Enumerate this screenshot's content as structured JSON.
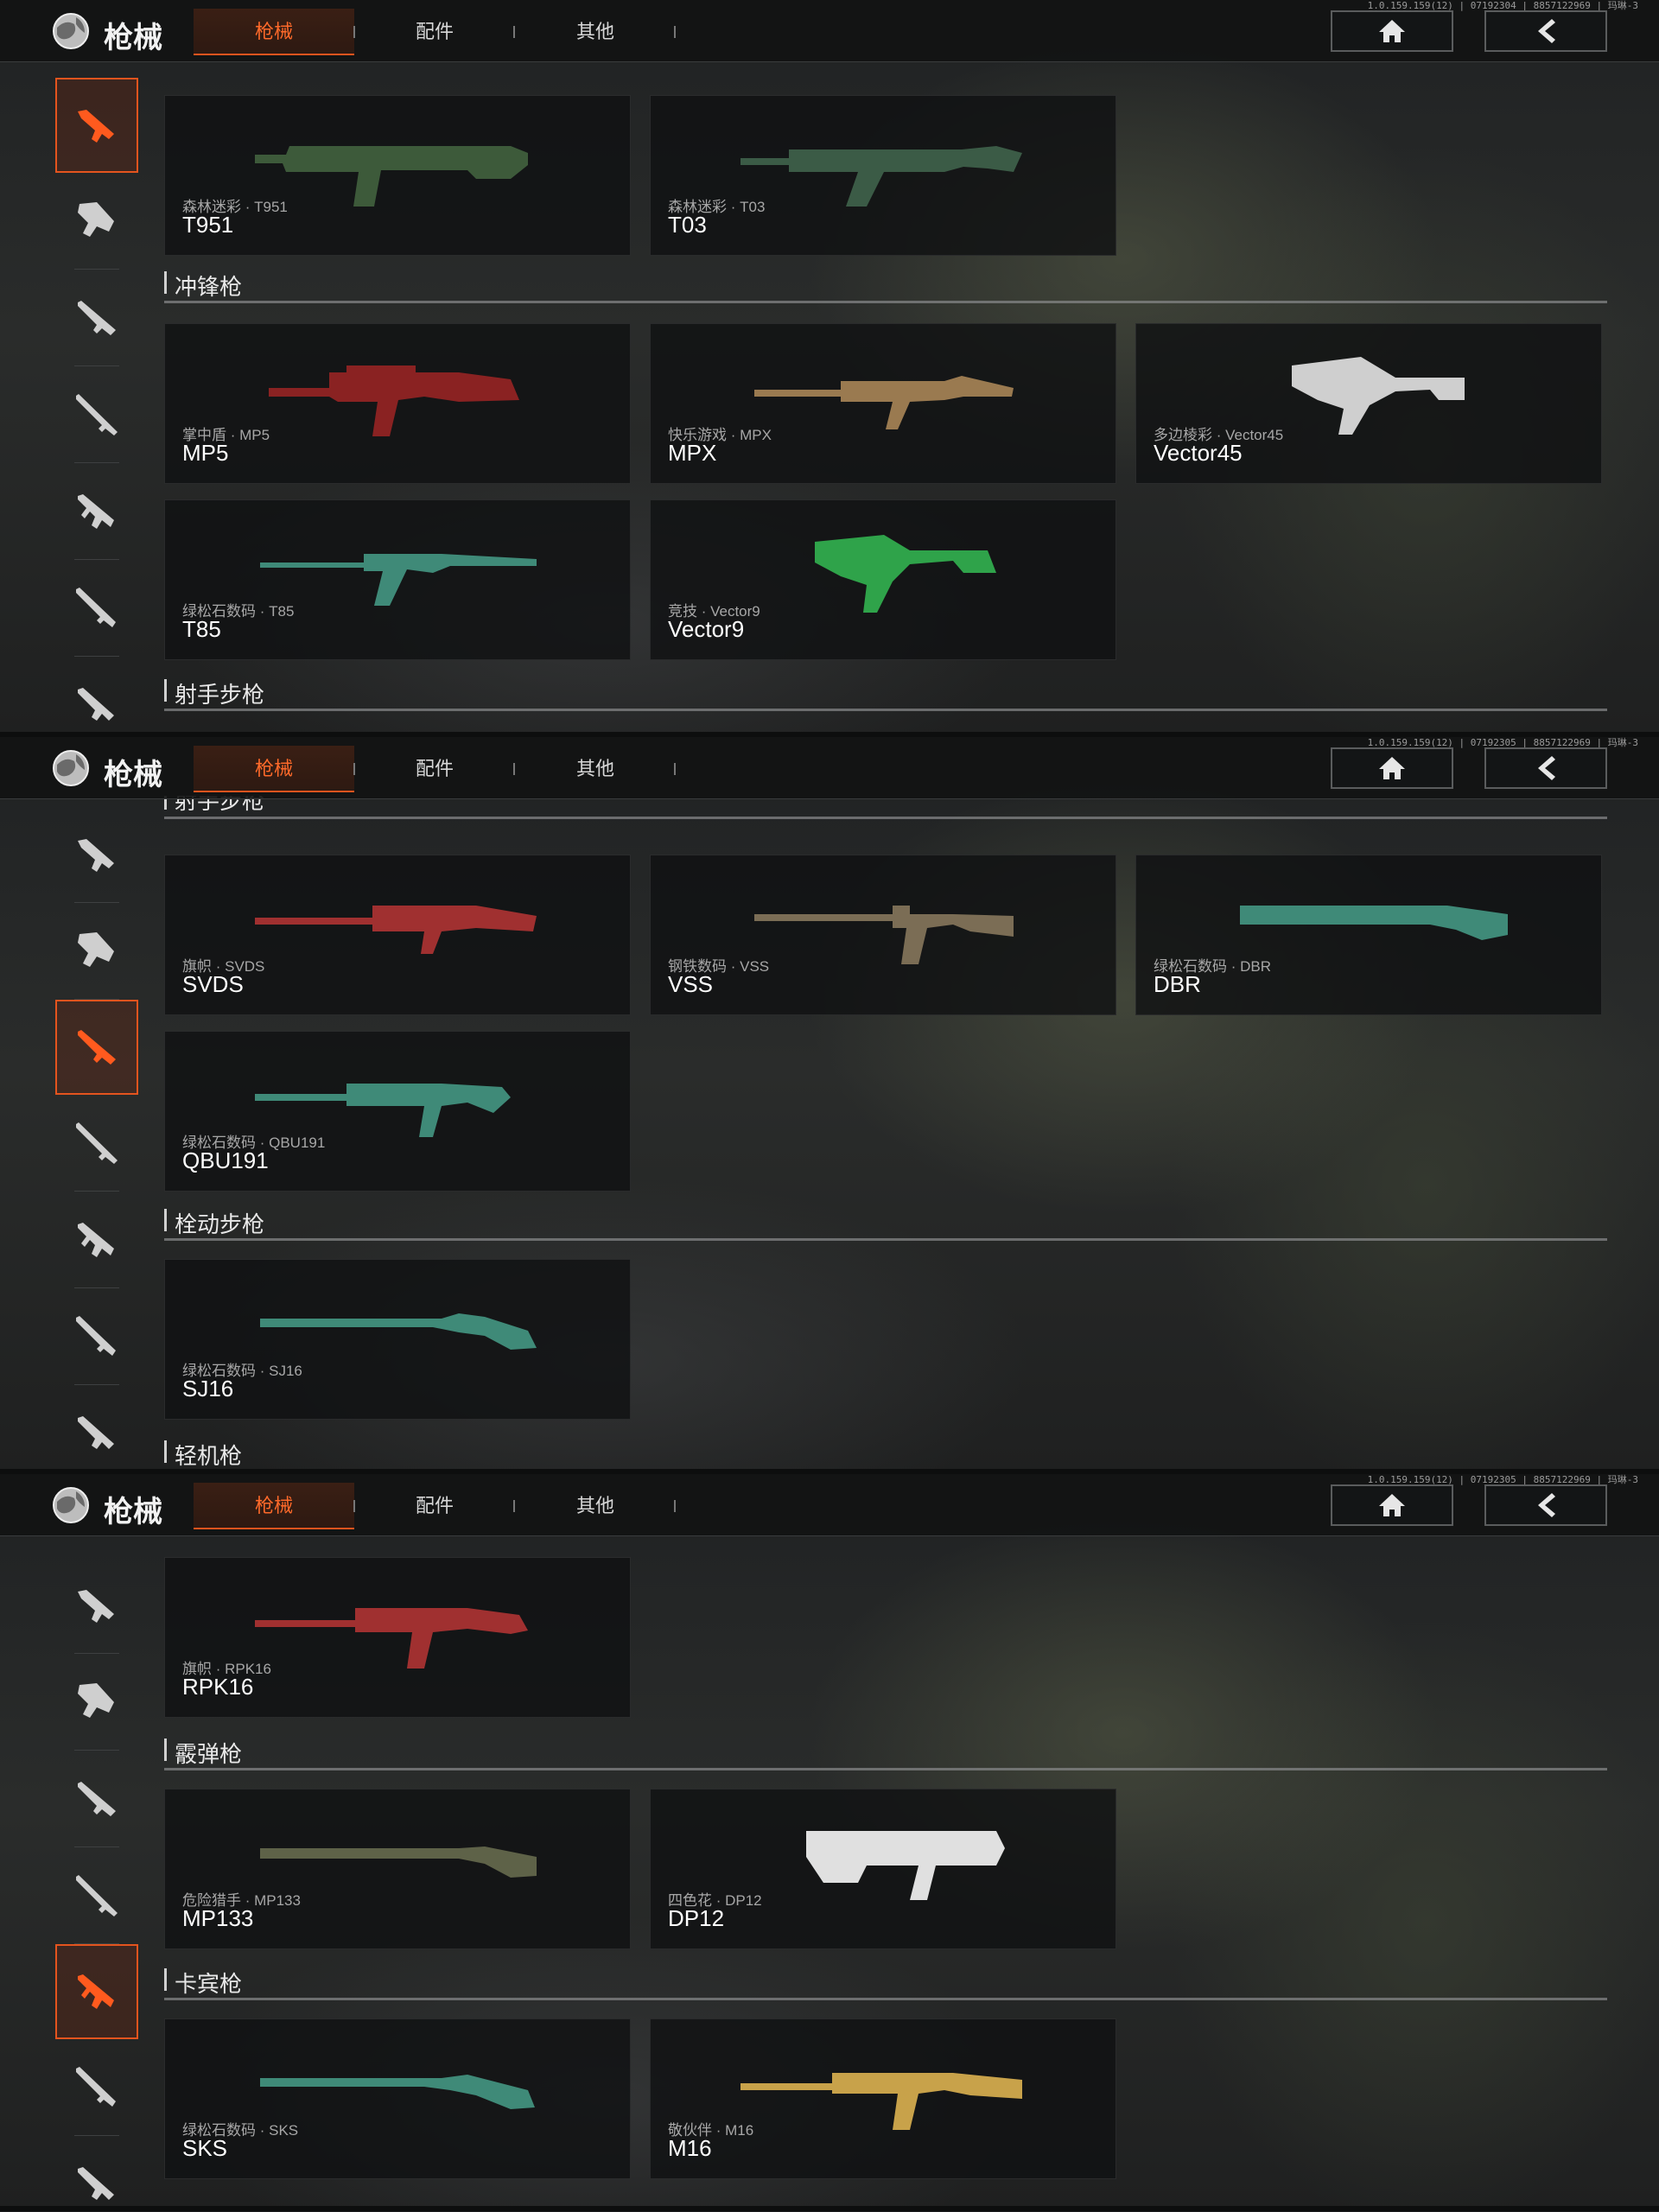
{
  "topbar": {
    "title": "枪械",
    "tabs": [
      "枪械",
      "配件",
      "其他"
    ],
    "versions": [
      "1.0.159.159(12) | 07192304 | 8857122969 | 玛琳-3",
      "1.0.159.159(12) | 07192305 | 8857122969 | 玛琳-3",
      "1.0.159.159(12) | 07192305 | 8857122969 | 玛琳-3"
    ],
    "home_icon": "home-icon",
    "back_icon": "chevron-left-icon"
  },
  "colors": {
    "accent": "#e4541e",
    "text": "#ffffff",
    "skin_text": "#a7a7a7"
  },
  "panel1": {
    "rifles": [
      {
        "skin": "森林迷彩 · T951",
        "name": "T951",
        "color": "#3d5a3a"
      },
      {
        "skin": "森林迷彩 · T03",
        "name": "T03",
        "color": "#3b5b46"
      }
    ],
    "smg_section": "冲锋枪",
    "smgs": [
      {
        "skin": "掌中盾 · MP5",
        "name": "MP5",
        "color": "#8a2222"
      },
      {
        "skin": "快乐游戏 · MPX",
        "name": "MPX",
        "color": "#9a7a50"
      },
      {
        "skin": "多边棱彩 · Vector45",
        "name": "Vector45",
        "color": "#cfcfcf"
      },
      {
        "skin": "绿松石数码 · T85",
        "name": "T85",
        "color": "#3f8a78"
      },
      {
        "skin": "竞技 · Vector9",
        "name": "Vector9",
        "color": "#2fa34a"
      }
    ],
    "dmr_section": "射手步枪"
  },
  "panel2": {
    "dmr_section_partial": "射手步枪",
    "dmrs": [
      {
        "skin": "旗帜 · SVDS",
        "name": "SVDS",
        "color": "#a03030"
      },
      {
        "skin": "钢铁数码 · VSS",
        "name": "VSS",
        "color": "#7b6d55"
      },
      {
        "skin": "绿松石数码 · DBR",
        "name": "DBR",
        "color": "#3f8a78"
      },
      {
        "skin": "绿松石数码 · QBU191",
        "name": "QBU191",
        "color": "#3f8a78"
      }
    ],
    "sniper_section": "栓动步枪",
    "snipers": [
      {
        "skin": "绿松石数码 · SJ16",
        "name": "SJ16",
        "color": "#3f8a78"
      }
    ],
    "lmg_section": "轻机枪"
  },
  "panel3": {
    "lmgs": [
      {
        "skin": "旗帜 · RPK16",
        "name": "RPK16",
        "color": "#a03030"
      }
    ],
    "shotgun_section": "霰弹枪",
    "shotguns": [
      {
        "skin": "危险猎手 · MP133",
        "name": "MP133",
        "color": "#5e6248"
      },
      {
        "skin": "四色花 · DP12",
        "name": "DP12",
        "color": "#e0e0e0"
      }
    ],
    "carbine_section": "卡宾枪",
    "carbines": [
      {
        "skin": "绿松石数码 · SKS",
        "name": "SKS",
        "color": "#3f8a78"
      },
      {
        "skin": "敬伙伴 · M16",
        "name": "M16",
        "color": "#c8a24a"
      }
    ]
  },
  "sidebar_icons": [
    "assault-rifle-icon",
    "smg-icon",
    "dmr-icon",
    "sniper-icon",
    "lmg-icon",
    "shotgun-icon",
    "carbine-icon"
  ]
}
